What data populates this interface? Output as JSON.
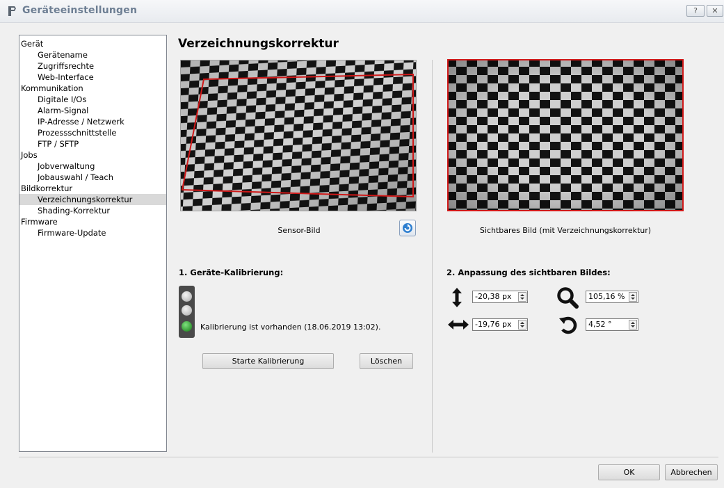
{
  "window": {
    "title": "Geräteeinstellungen",
    "help_label": "?",
    "close_label": "✕"
  },
  "nav": {
    "items": [
      {
        "label": "Gerät",
        "level": 0
      },
      {
        "label": "Gerätename",
        "level": 1
      },
      {
        "label": "Zugriffsrechte",
        "level": 1
      },
      {
        "label": "Web-Interface",
        "level": 1
      },
      {
        "label": "Kommunikation",
        "level": 0
      },
      {
        "label": "Digitale I/Os",
        "level": 1
      },
      {
        "label": "Alarm-Signal",
        "level": 1
      },
      {
        "label": "IP-Adresse / Netzwerk",
        "level": 1
      },
      {
        "label": "Prozessschnittstelle",
        "level": 1
      },
      {
        "label": "FTP / SFTP",
        "level": 1
      },
      {
        "label": "Jobs",
        "level": 0
      },
      {
        "label": "Jobverwaltung",
        "level": 1
      },
      {
        "label": "Jobauswahl / Teach",
        "level": 1
      },
      {
        "label": "Bildkorrektur",
        "level": 0
      },
      {
        "label": "Verzeichnungskorrektur",
        "level": 1,
        "selected": true
      },
      {
        "label": "Shading-Korrektur",
        "level": 1
      },
      {
        "label": "Firmware",
        "level": 0
      },
      {
        "label": "Firmware-Update",
        "level": 1
      }
    ]
  },
  "main": {
    "title": "Verzeichnungskorrektur",
    "sensor_caption": "Sensor-Bild",
    "visible_caption": "Sichtbares Bild (mit Verzeichnungskorrektur)",
    "calibration": {
      "heading": "1. Geräte-Kalibrierung:",
      "status": "Kalibrierung ist vorhanden (18.06.2019 13:02).",
      "start_button": "Starte Kalibrierung",
      "delete_button": "Löschen"
    },
    "adjust": {
      "heading": "2. Anpassung des sichtbaren Bildes:",
      "vertical_offset": "-20,38 px",
      "horizontal_offset": "-19,76 px",
      "zoom": "105,16 %",
      "rotation": "4,52 °"
    }
  },
  "footer": {
    "ok_label": "OK",
    "cancel_label": "Abbrechen"
  },
  "colors": {
    "roi_red": "#d01818",
    "status_green": "#1a9a1a"
  }
}
